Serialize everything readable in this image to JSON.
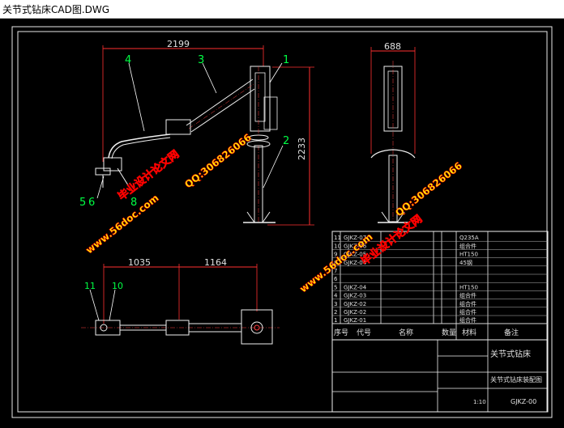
{
  "window": {
    "title": "关节式钻床CAD图.DWG"
  },
  "drawing": {
    "dimensions": {
      "front_width": "2199",
      "front_height": "2233",
      "side_width": "688",
      "plan_left": "1035",
      "plan_right": "1164"
    },
    "part_callouts": {
      "p1": "1",
      "p2": "2",
      "p3": "3",
      "p4": "4",
      "p5": "5",
      "p6": "6",
      "p8": "8",
      "p10": "10",
      "p11": "11"
    },
    "watermarks": {
      "site": "www.56doc.com",
      "brand": "毕业设计论文网",
      "qq": "QQ:306826066"
    },
    "parts_list": [
      {
        "no": "11",
        "code": "GJKZ-07",
        "material": "Q235A"
      },
      {
        "no": "10",
        "code": "GJKZ-06",
        "material": "组合件"
      },
      {
        "no": "9",
        "code": "GJKZ-05",
        "material": "HT150"
      },
      {
        "no": "8",
        "code": "GJKZ-04",
        "material": "45钢"
      },
      {
        "no": "7",
        "code": "",
        "material": ""
      },
      {
        "no": "6",
        "code": "",
        "material": ""
      },
      {
        "no": "5",
        "code": "GJKZ-04",
        "material": "HT150"
      },
      {
        "no": "4",
        "code": "GJKZ-03",
        "material": "组合件"
      },
      {
        "no": "3",
        "code": "GJKZ-02",
        "material": "组合件"
      },
      {
        "no": "2",
        "code": "GJKZ-02",
        "material": "组合件"
      },
      {
        "no": "1",
        "code": "GJKZ-01",
        "material": "组合件"
      }
    ],
    "title_block": {
      "header_no": "序号",
      "header_code": "代号",
      "header_name": "名称",
      "header_qty": "数量",
      "header_material": "材料",
      "header_note": "备注",
      "product_name": "关节式钻床",
      "drawing_name": "关节式钻床装配图",
      "drawing_code": "GJKZ-00",
      "scale": "1:10"
    }
  }
}
